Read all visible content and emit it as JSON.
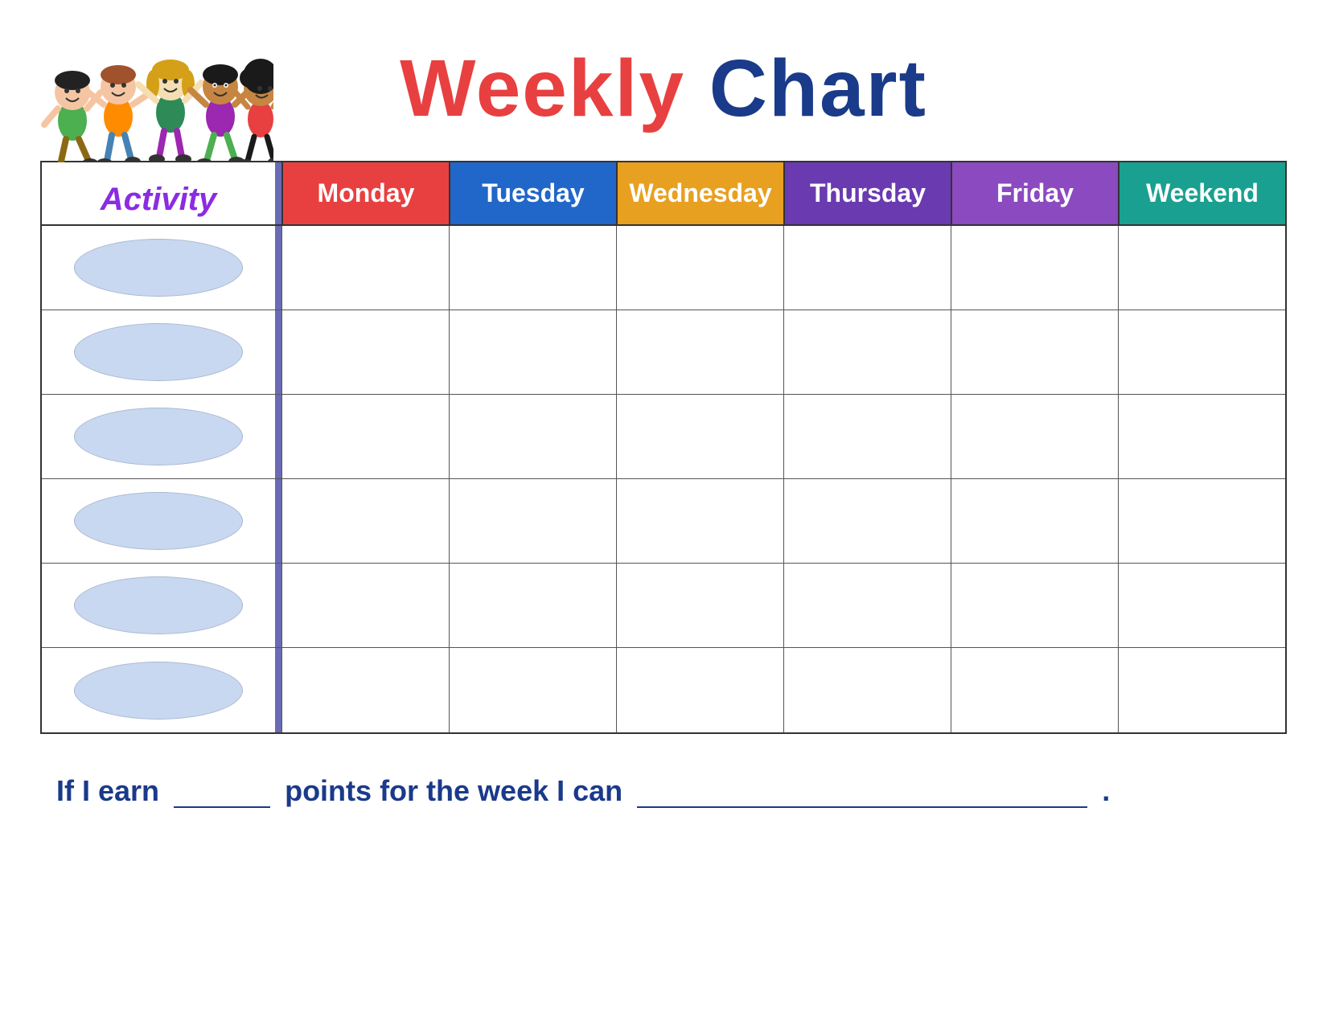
{
  "title": {
    "weekly": "Weekly",
    "chart": "Chart"
  },
  "activity_label": "Activity",
  "days": [
    {
      "label": "Monday",
      "class": "day-monday"
    },
    {
      "label": "Tuesday",
      "class": "day-tuesday"
    },
    {
      "label": "Wednesday",
      "class": "day-wednesday"
    },
    {
      "label": "Thursday",
      "class": "day-thursday"
    },
    {
      "label": "Friday",
      "class": "day-friday"
    },
    {
      "label": "Weekend",
      "class": "day-weekend"
    }
  ],
  "rows": [
    0,
    1,
    2,
    3,
    4,
    5
  ],
  "footer": {
    "text1": "If I earn",
    "text2": "points for the week I can",
    "period": "."
  },
  "colors": {
    "title_weekly": "#e84040",
    "title_chart": "#1a3a8a",
    "activity_label": "#8b2be2",
    "vertical_bar": "#6a6ab5",
    "monday": "#e84040",
    "tuesday": "#2166c9",
    "wednesday": "#e8a020",
    "thursday": "#6a3ab0",
    "friday": "#8b4ac0",
    "weekend": "#1aa090",
    "oval": "#c8d8f0"
  }
}
